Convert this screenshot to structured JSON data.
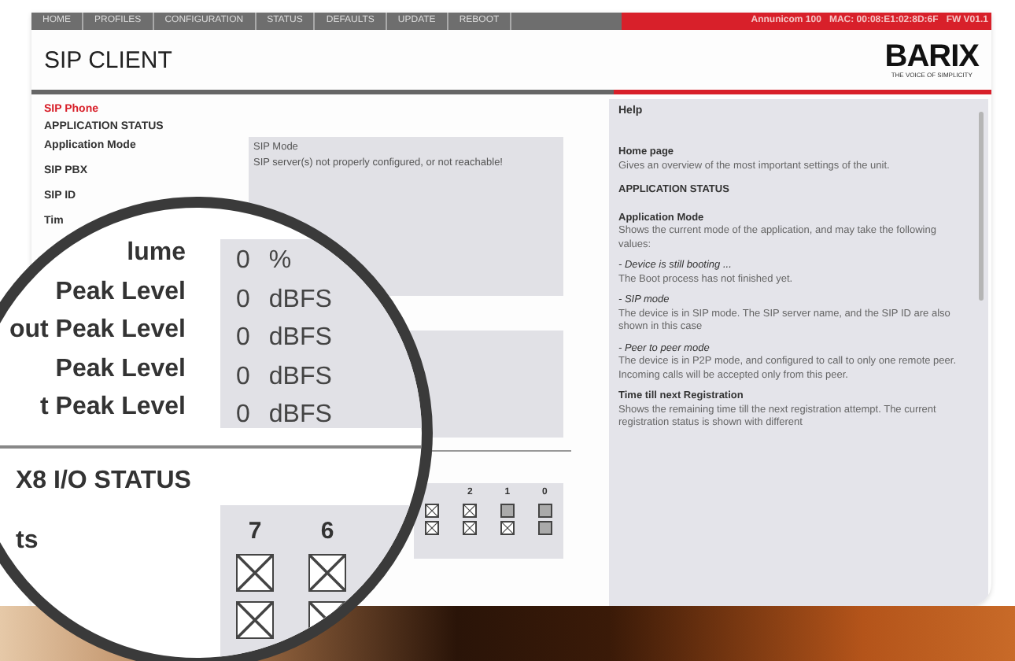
{
  "nav": {
    "items": [
      "HOME",
      "PROFILES",
      "CONFIGURATION",
      "STATUS",
      "DEFAULTS",
      "UPDATE",
      "REBOOT"
    ],
    "device": [
      "Annunicom 100",
      "MAC: 00:08:E1:02:8D:6F",
      "FW V01.1"
    ]
  },
  "header": {
    "title": "SIP CLIENT",
    "logo": "BARIX",
    "tagline": "THE VOICE OF SIMPLICITY"
  },
  "status": {
    "page_label": "SIP Phone",
    "section": "APPLICATION STATUS",
    "labels": [
      "Application Mode",
      "SIP PBX",
      "SIP ID",
      "Tim"
    ],
    "mode": "SIP Mode",
    "message": "SIP server(s) not properly configured, or not reachable!"
  },
  "io_small": {
    "columns": [
      {
        "states": [
          true,
          true
        ]
      },
      {
        "label": "2",
        "states": [
          true,
          true
        ]
      },
      {
        "label": "1",
        "states": [
          false,
          true
        ]
      },
      {
        "label": "0",
        "states": [
          false,
          false
        ]
      }
    ]
  },
  "magnifier": {
    "rows": [
      {
        "label": "lume",
        "value": "0",
        "unit": "%"
      },
      {
        "label": "Peak Level",
        "value": "0",
        "unit": "dBFS"
      },
      {
        "label": "out Peak Level",
        "value": "0",
        "unit": "dBFS"
      },
      {
        "label": "Peak Level",
        "value": "0",
        "unit": "dBFS"
      },
      {
        "label": "t Peak Level",
        "value": "0",
        "unit": "dBFS"
      }
    ],
    "section": "X8 I/O STATUS",
    "io_label": "ts",
    "columns": [
      {
        "label": "7",
        "states": [
          true,
          true
        ]
      },
      {
        "label": "6",
        "states": [
          true,
          true
        ]
      }
    ]
  },
  "help": {
    "title": "Help",
    "blocks": [
      {
        "kind": "heading",
        "text": "Home page"
      },
      {
        "kind": "text",
        "text": "Gives an overview of the most important settings of the unit."
      },
      {
        "kind": "section",
        "text": "APPLICATION STATUS"
      },
      {
        "kind": "heading",
        "text": "Application Mode"
      },
      {
        "kind": "text",
        "text": "Shows the current mode of the application, and may take the following values:"
      },
      {
        "kind": "option",
        "text": "- Device is still booting ..."
      },
      {
        "kind": "text",
        "text": "The Boot process has not finished yet."
      },
      {
        "kind": "option",
        "text": "- SIP mode"
      },
      {
        "kind": "text",
        "text": "The device is in SIP mode. The SIP server name, and the SIP ID are also shown in this case"
      },
      {
        "kind": "option",
        "text": "- Peer to peer mode"
      },
      {
        "kind": "text",
        "text": "The device is in P2P mode, and configured to call to only one remote peer. Incoming calls will be accepted only from this peer."
      },
      {
        "kind": "heading",
        "text": "Time till next Registration"
      },
      {
        "kind": "text",
        "text": "Shows the remaining time till the next registration attempt. The current registration status is shown with different"
      }
    ]
  }
}
